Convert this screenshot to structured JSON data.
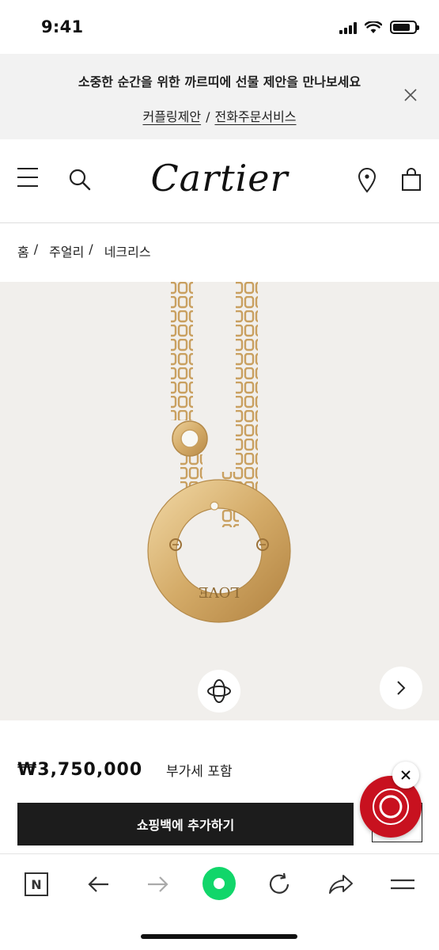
{
  "status_bar": {
    "time": "9:41"
  },
  "promo": {
    "text": "소중한 순간을 위한 까르띠에 선물 제안을 만나보세요",
    "link_couple": "커플링제안",
    "separator": "/",
    "link_phone": "전화주문서비스"
  },
  "header": {
    "logo": "Cartier"
  },
  "breadcrumb": {
    "items": [
      "홈",
      "주얼리",
      "네크리스"
    ],
    "separator": "/"
  },
  "product": {
    "engraving": "LOVE",
    "price": "₩3,750,000",
    "vat_note": "부가세 포함",
    "add_to_bag": "쇼핑백에 추가하기"
  },
  "colors": {
    "brand_red": "#c8111f",
    "dark_button": "#1c1c1c",
    "accent_green": "#11d66a",
    "image_background": "#f1efec",
    "gold": "#d8b373"
  },
  "toolbar": {
    "n_label": "N",
    "icons": [
      "n-home-icon",
      "back-arrow-icon",
      "forward-arrow-icon",
      "green-dot-icon",
      "refresh-icon",
      "share-icon",
      "menu-icon"
    ]
  }
}
